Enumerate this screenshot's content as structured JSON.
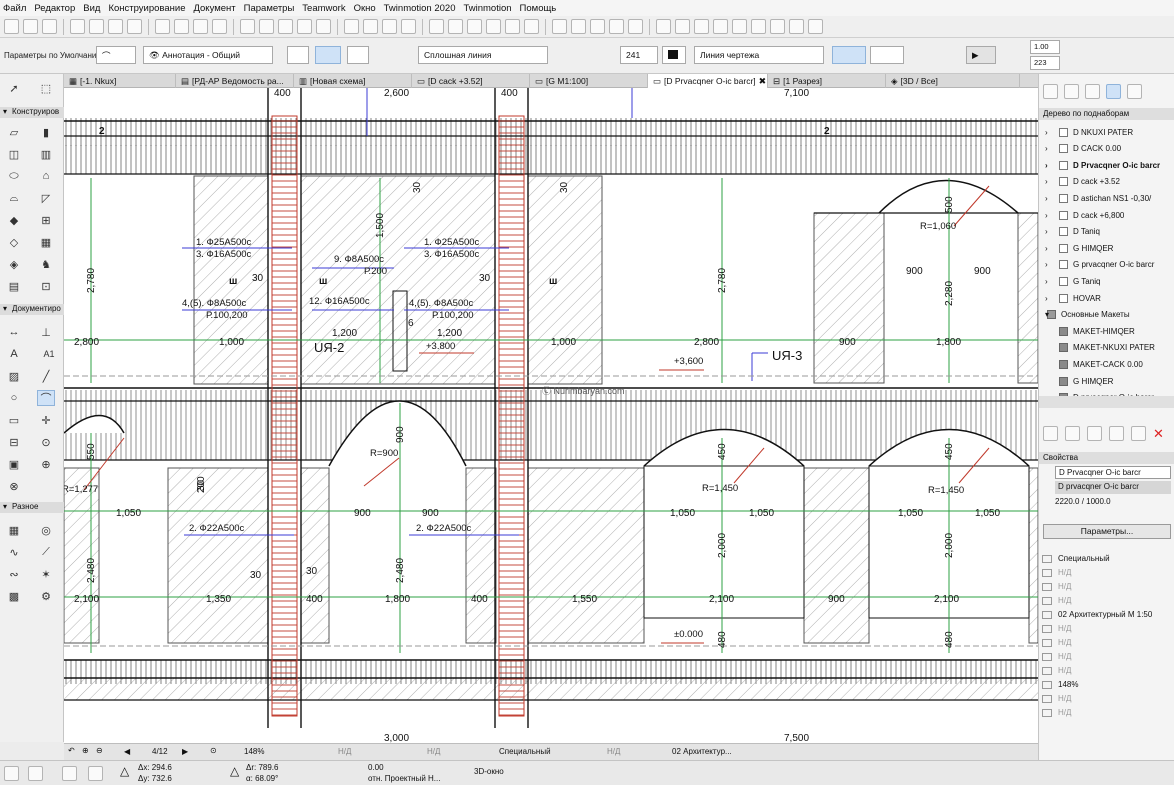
{
  "menu": [
    "Файл",
    "Редактор",
    "Вид",
    "Конструирование",
    "Документ",
    "Параметры",
    "Teamwork",
    "Окно",
    "Twinmotion 2020",
    "Twinmotion",
    "Помощь"
  ],
  "infobox": {
    "preset": "Параметры по Умолчанию",
    "layer": "Аннотация - Общий",
    "line_type": "Сплошная линия",
    "pen_number": "241",
    "line_category": "Линия чертежа",
    "val_top": "1.00",
    "val_bottom": "223"
  },
  "tabs": [
    "[-1. Nkux]",
    "[РД-АР Ведомость ра...",
    "[Новая схема]",
    "[D cack +3.52]",
    "[G M1:100]",
    "[D Prvacqner O-ic barcr]",
    "[1 Разрез]",
    "[3D / Все]"
  ],
  "active_tab_index": 5,
  "left_panel": {
    "section_design": "Конструиров",
    "section_document": "Документиро",
    "section_misc": "Разное",
    "tool_a1": "A1"
  },
  "right_panel": {
    "title": "Дерево по поднаборам",
    "tree": [
      {
        "label": "D NKUXI PATER"
      },
      {
        "label": "D CACK 0.00"
      },
      {
        "label": "D Prvacqner O-ic barcr",
        "selected": true
      },
      {
        "label": "D cack +3.52"
      },
      {
        "label": "D astichan NS1 -0,30/"
      },
      {
        "label": "D cack +6,800"
      },
      {
        "label": "D Taniq"
      },
      {
        "label": "G HIMQER"
      },
      {
        "label": "G prvacqner O-ic barcr"
      },
      {
        "label": "G Taniq"
      },
      {
        "label": "HOVAR"
      },
      {
        "label": "Основные Макеты",
        "folder": true
      },
      {
        "label": "MAKET-HIMQER",
        "layout": true
      },
      {
        "label": "MAKET-NKUXI PATER",
        "layout": true
      },
      {
        "label": "MAKET-CACK 0.00",
        "layout": true
      },
      {
        "label": "G HIMQER",
        "layout": true
      },
      {
        "label": "D prvacqner O-ic barcr",
        "layout": true
      }
    ],
    "properties_title": "Свойства",
    "prop_name": "D Prvacqner O-ic barcr",
    "prop_ref": "D prvacqner O-ic barcr",
    "prop_scale": "2220.0 / 1000.0",
    "params_button": "Параметры...",
    "rows": [
      {
        "t": "Специальный",
        "dim": false
      },
      {
        "t": "Н/Д",
        "dim": true
      },
      {
        "t": "Н/Д",
        "dim": true
      },
      {
        "t": "Н/Д",
        "dim": true
      },
      {
        "t": "02 Архитектурный М 1:50",
        "dim": false
      },
      {
        "t": "Н/Д",
        "dim": true
      },
      {
        "t": "Н/Д",
        "dim": true
      },
      {
        "t": "Н/Д",
        "dim": true
      },
      {
        "t": "Н/Д",
        "dim": true
      },
      {
        "t": "148%",
        "dim": false
      },
      {
        "t": "Н/Д",
        "dim": true
      },
      {
        "t": "Н/Д",
        "dim": true
      }
    ]
  },
  "navbar": {
    "page": "4/12",
    "zoom": "148%",
    "nd1": "Н/Д",
    "nd2": "Н/Д",
    "special": "Специальный",
    "nd3": "Н/Д",
    "scale": "02 Архитектур..."
  },
  "statusbar": {
    "dx": "Δx: 294.6",
    "dy": "Δy: 732.6",
    "dr": "Δr: 789.6",
    "da": "α: 68.09°",
    "zero": "0.00",
    "project": "отн. Проектный Н...",
    "view3d": "3D-окно"
  },
  "drawing": {
    "top_dims": [
      "400",
      "2,600",
      "400",
      "7,100"
    ],
    "bottom_dims": [
      "3,000",
      "7,500"
    ],
    "axis": "2",
    "dims_upper": [
      "2,780",
      "2,800",
      "1,000",
      "1,200",
      "1,200",
      "1,000",
      "2,800",
      "900",
      "1,800",
      "2,780",
      "2,280",
      "900",
      "900",
      "500",
      "1,500",
      "30",
      "30",
      "30",
      "30",
      "200",
      "6"
    ],
    "dims_lower": [
      "550",
      "1,050",
      "900",
      "900",
      "1,050",
      "1,050",
      "1,050",
      "1,050",
      "2,480",
      "2,480",
      "2,100",
      "1,350",
      "400",
      "1,800",
      "400",
      "1,550",
      "2,100",
      "900",
      "2,100",
      "2,000",
      "2,000",
      "450",
      "450",
      "900",
      "480",
      "480",
      "30",
      "30",
      "30"
    ],
    "rebar": [
      "1.  Ф25А500с",
      "3.  Ф16А500с",
      "9.  Ф8А500с",
      "Р.200",
      "12.  Ф16А500с",
      "4,(5).  Ф8А500с",
      "Р.100,200",
      "1.  Ф25А500с",
      "3.  Ф16А500с",
      "4,(5).  Ф8А500с",
      "Р.100,200",
      "2.  Ф22А500с",
      "2.  Ф22А500с"
    ],
    "radii": [
      "R=1,060",
      "R=900",
      "R=1,277",
      "R=1,450",
      "R=1,450"
    ],
    "levels": [
      "+3.800",
      "+3,600",
      "±0.000"
    ],
    "sections": [
      "UЯ-2",
      "UЯ-3"
    ],
    "marks": [
      "ш",
      "ш",
      "ш"
    ],
    "watermark": "Ⓒ Nurimbaryan.com"
  }
}
